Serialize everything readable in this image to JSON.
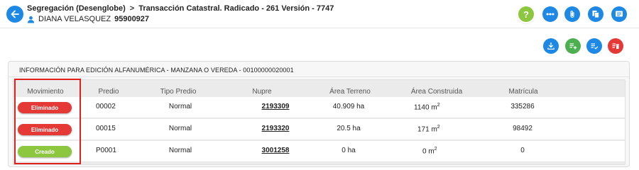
{
  "header": {
    "title": "Segregación (Desenglobe)",
    "subtitle": "Transacción Catastral. Radicado - 261 Versión - 7747",
    "user_name": "DIANA VELASQUEZ",
    "user_id": "95900927",
    "help_label": "?"
  },
  "colors": {
    "primary": "#1e88e5",
    "green": "#8dc63f",
    "red": "#e53935",
    "highlight": "#e0201b"
  },
  "panel": {
    "title": "INFORMACIÓN PARA EDICIÓN ALFANUMÉRICA - MANZANA O VEREDA - 00100000020001"
  },
  "table": {
    "headers": [
      "Movimiento",
      "Predio",
      "Tipo Predio",
      "Nupre",
      "Área Terreno",
      "Área Construida",
      "Matrícula"
    ],
    "rows": [
      {
        "movimiento": "Eliminado",
        "status": "red",
        "predio": "00002",
        "tipo": "Normal",
        "nupre": "2193309",
        "area_terreno": "40.909 ha",
        "area_construida": "1140 m",
        "matricula": "335286"
      },
      {
        "movimiento": "Eliminado",
        "status": "red",
        "predio": "00015",
        "tipo": "Normal",
        "nupre": "2193320",
        "area_terreno": "20.5 ha",
        "area_construida": "171 m",
        "matricula": "98492"
      },
      {
        "movimiento": "Creado",
        "status": "green",
        "predio": "P0001",
        "tipo": "Normal",
        "nupre": "3001258",
        "area_terreno": "0 ha",
        "area_construida": "0 m",
        "matricula": "0"
      }
    ],
    "unit_exponent": "2"
  }
}
